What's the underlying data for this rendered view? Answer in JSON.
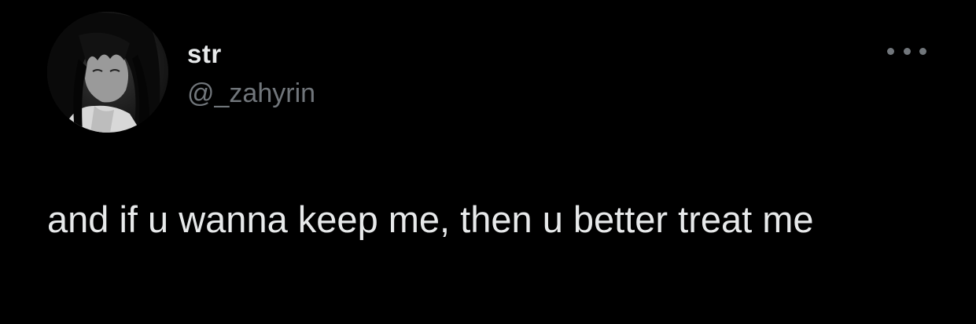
{
  "author": {
    "display_name": "str",
    "handle": "@_zahyrin",
    "avatar_icon": "avatar-image"
  },
  "tweet": {
    "text": "and if u wanna keep me, then u better treat me"
  },
  "actions": {
    "more_icon": "more-horizontal-icon"
  },
  "colors": {
    "background": "#000000",
    "primary_text": "#e7e9ea",
    "secondary_text": "#71767b"
  }
}
